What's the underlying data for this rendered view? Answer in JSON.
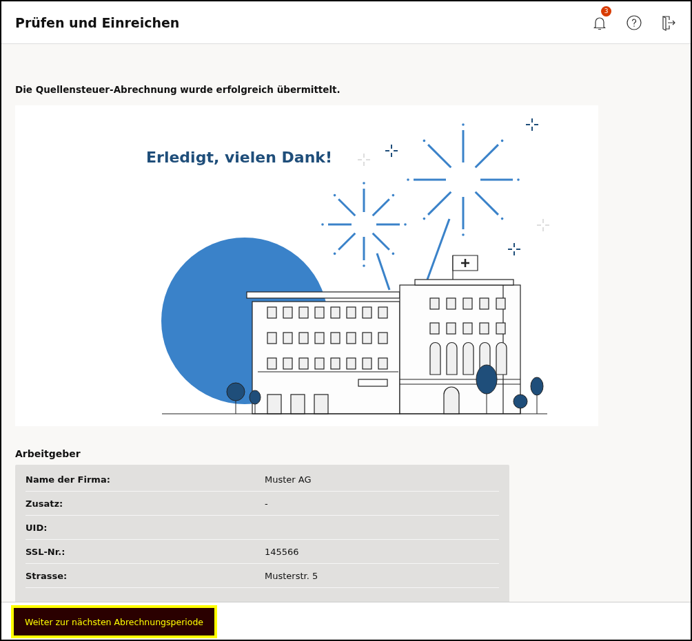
{
  "header": {
    "title": "Prüfen und Einreichen",
    "notification_count": "3"
  },
  "message": "Die Quellensteuer-Abrechnung wurde erfolgreich übermittelt.",
  "illustration": {
    "headline": "Erledigt, vielen Dank!"
  },
  "employer": {
    "title": "Arbeitgeber",
    "rows": [
      {
        "label": "Name der Firma:",
        "value": "Muster AG"
      },
      {
        "label": "Zusatz:",
        "value": "-"
      },
      {
        "label": "UID:"
      },
      {
        "label": "SSL-Nr.:",
        "value": "145566"
      },
      {
        "label": "Strasse:",
        "value": "Musterstr. 5"
      }
    ]
  },
  "footer": {
    "button": "Weiter zur nächsten Abrechnungsperiode"
  }
}
